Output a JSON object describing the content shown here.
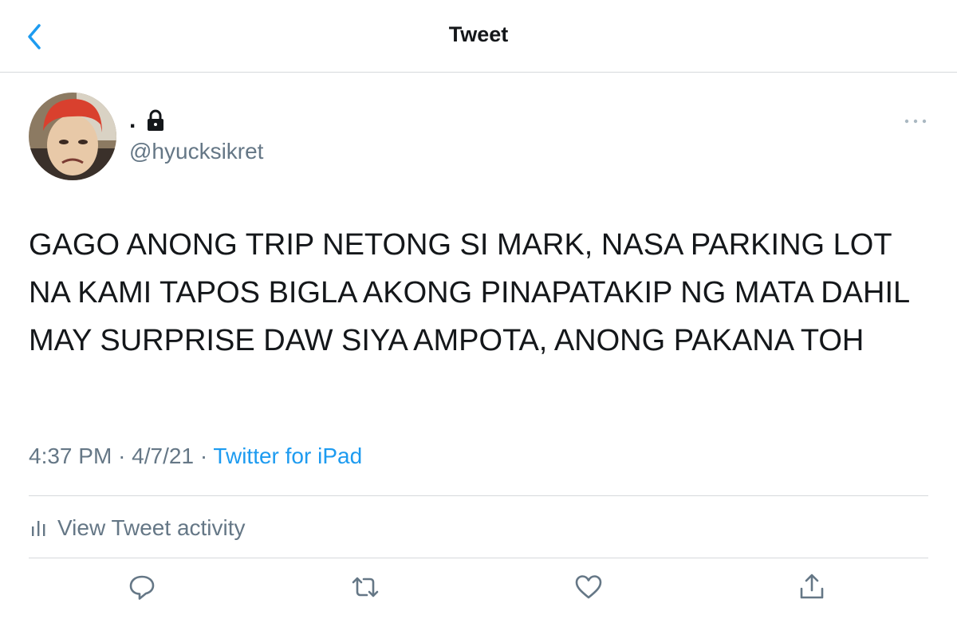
{
  "header": {
    "title": "Tweet",
    "back_icon": "chevron-left-icon"
  },
  "tweet": {
    "display_name": ".",
    "protected_icon": "lock-icon",
    "handle": "@hyucksikret",
    "text": "GAGO ANONG TRIP NETONG SI MARK, NASA PARKING LOT NA KAMI TAPOS BIGLA AKONG PINAPATAKIP NG MATA DAHIL MAY SURPRISE DAW SIYA AMPOTA, ANONG PAKANA TOH",
    "time": "4:37 PM",
    "separator": "·",
    "date": "4/7/21",
    "source": "Twitter for iPad"
  },
  "activity": {
    "label": "View Tweet activity",
    "icon": "bar-chart-icon"
  },
  "actions": [
    {
      "name": "reply",
      "icon": "reply-icon"
    },
    {
      "name": "retweet",
      "icon": "retweet-icon"
    },
    {
      "name": "like",
      "icon": "heart-icon"
    },
    {
      "name": "share",
      "icon": "share-icon"
    }
  ],
  "colors": {
    "accent": "#1d9bf0",
    "text": "#14171a",
    "secondary": "#657786",
    "divider": "#d6d9dc"
  }
}
